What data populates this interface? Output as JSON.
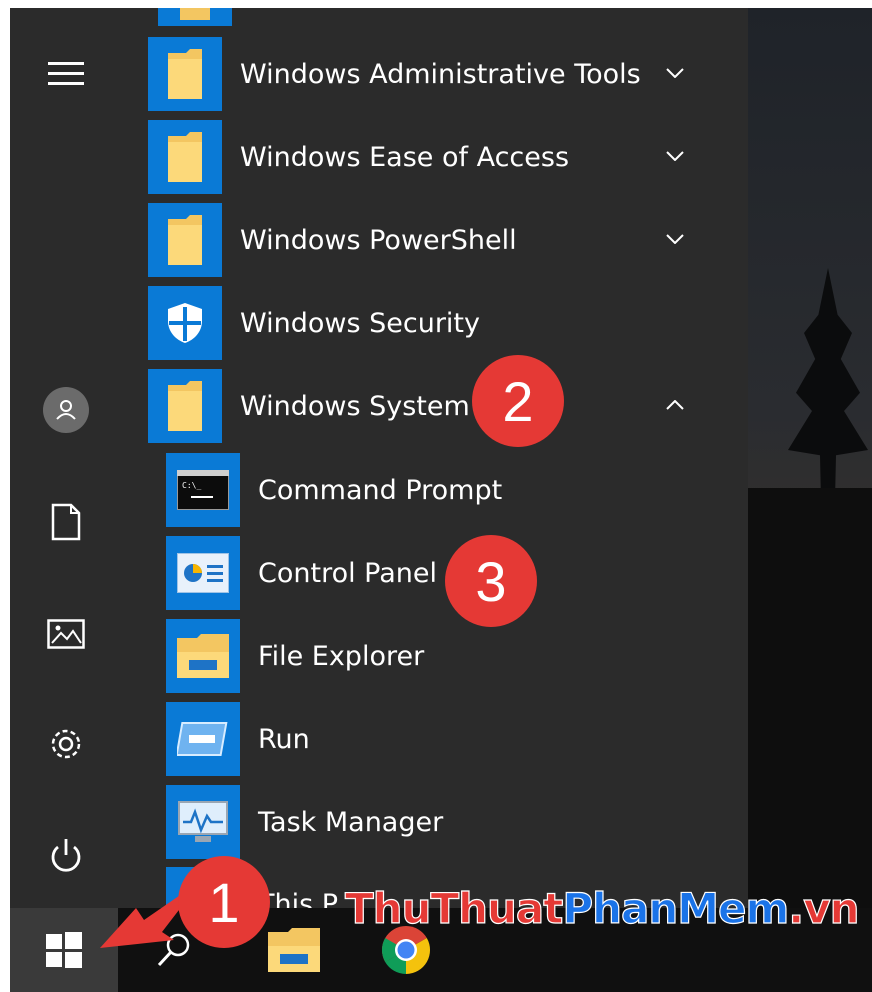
{
  "start_menu": {
    "apps": [
      {
        "label": "Windows Administrative Tools",
        "expanded": false,
        "icon": "folder-icon"
      },
      {
        "label": "Windows Ease of Access",
        "expanded": false,
        "icon": "folder-icon"
      },
      {
        "label": "Windows PowerShell",
        "expanded": false,
        "icon": "folder-icon"
      },
      {
        "label": "Windows Security",
        "icon": "shield-icon"
      },
      {
        "label": "Windows System",
        "expanded": true,
        "icon": "folder-icon"
      }
    ],
    "subitems": [
      {
        "label": "Command Prompt",
        "icon": "command-prompt-icon"
      },
      {
        "label": "Control Panel",
        "icon": "control-panel-icon"
      },
      {
        "label": "File Explorer",
        "icon": "file-explorer-icon"
      },
      {
        "label": "Run",
        "icon": "run-icon"
      },
      {
        "label": "Task Manager",
        "icon": "task-manager-icon"
      },
      {
        "label": "This P",
        "icon": "this-pc-icon"
      }
    ]
  },
  "rail": [
    "hamburger-menu-icon",
    "user-icon",
    "documents-icon",
    "pictures-icon",
    "settings-icon",
    "power-icon"
  ],
  "taskbar": [
    "windows-start-icon",
    "search-icon",
    "file-explorer-icon",
    "chrome-icon"
  ],
  "annotations": {
    "step1": "1",
    "step2": "2",
    "step3": "3"
  },
  "watermark": {
    "part1": "ThuThuat",
    "part2": "PhanMem",
    "part3": ".vn"
  },
  "colors": {
    "accent": "#0a7ad6",
    "menu_bg": "#2b2b2b",
    "badge": "#e53935"
  }
}
